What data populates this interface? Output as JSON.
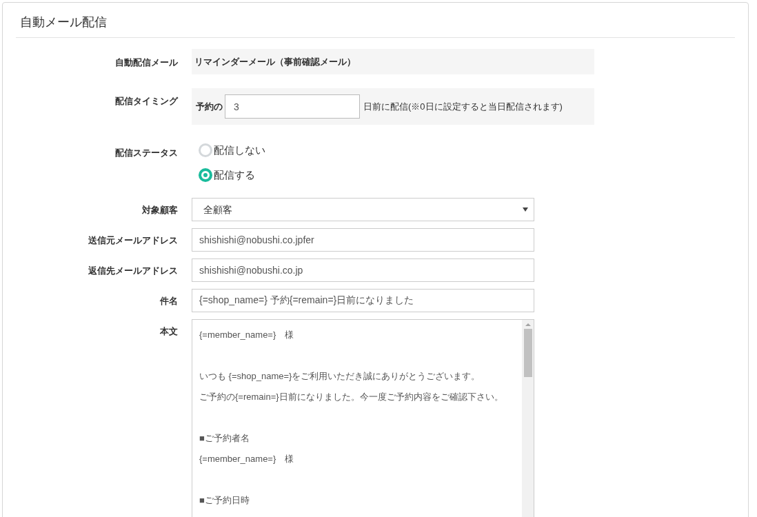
{
  "panel": {
    "title": "自動メール配信"
  },
  "auto_mail": {
    "label": "自動配信メール",
    "value": "リマインダーメール（事前確認メール）"
  },
  "timing": {
    "label": "配信タイミング",
    "prefix": "予約の",
    "value": "3",
    "suffix": "日前に配信(※0日に設定すると当日配信されます)"
  },
  "status": {
    "label": "配信ステータス",
    "options": [
      {
        "label": "配信しない",
        "selected": false
      },
      {
        "label": "配信する",
        "selected": true
      }
    ]
  },
  "target": {
    "label": "対象顧客",
    "value": "全顧客"
  },
  "sender": {
    "label": "送信元メールアドレス",
    "value": "shishishi@nobushi.co.jpfer"
  },
  "reply_to": {
    "label": "返信先メールアドレス",
    "value": "shishishi@nobushi.co.jp"
  },
  "subject": {
    "label": "件名",
    "value": "{=shop_name=} 予約{=remain=}日前になりました"
  },
  "body": {
    "label": "本文",
    "lines": [
      {
        "text": "{=member_name=}　様",
        "spaced": false
      },
      {
        "text": "いつも {=shop_name=}をご利用いただき誠にありがとうございます。",
        "spaced": true
      },
      {
        "text": "ご予約の{=remain=}日前になりました。今一度ご予約内容をご確認下さい。",
        "spaced": false
      },
      {
        "text": "■ご予約者名",
        "spaced": true
      },
      {
        "text": "{=member_name=}　様",
        "spaced": false
      },
      {
        "text": "■ご予約日時",
        "spaced": true
      }
    ]
  }
}
